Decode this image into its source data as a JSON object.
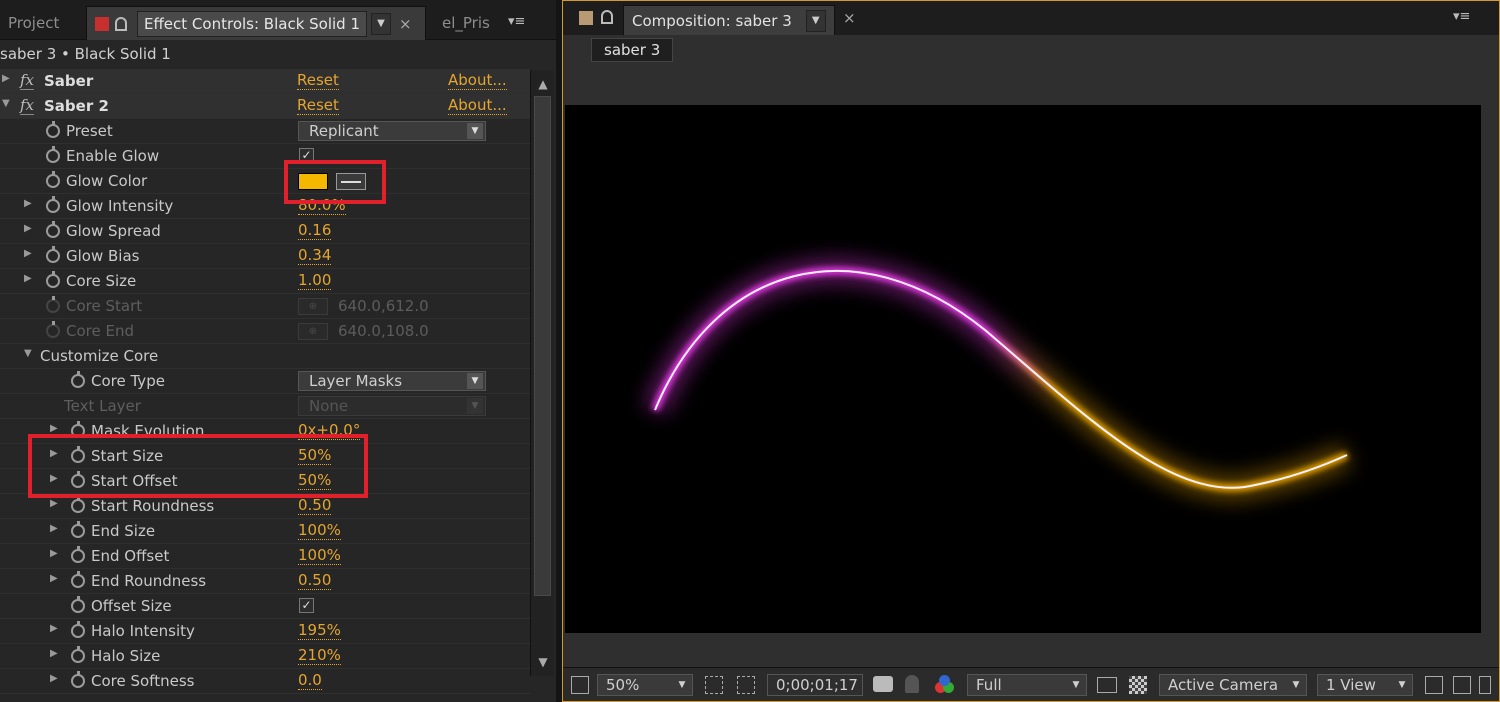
{
  "effect_panel": {
    "tabs": {
      "project": "Project",
      "effect_controls": "Effect Controls: Black Solid 1",
      "truncated": "el_Pris"
    },
    "breadcrumb": "saber 3 • Black Solid 1",
    "effects": [
      {
        "name": "Saber",
        "reset": "Reset",
        "about": "About..."
      },
      {
        "name": "Saber 2",
        "reset": "Reset",
        "about": "About..."
      }
    ],
    "preset": {
      "label": "Preset",
      "value": "Replicant"
    },
    "enable_glow": {
      "label": "Enable Glow",
      "checked": true
    },
    "glow_color": {
      "label": "Glow Color",
      "color": "#f4b800"
    },
    "glow_intensity": {
      "label": "Glow Intensity",
      "value": "80.0%"
    },
    "glow_spread": {
      "label": "Glow Spread",
      "value": "0.16"
    },
    "glow_bias": {
      "label": "Glow Bias",
      "value": "0.34"
    },
    "core_size": {
      "label": "Core Size",
      "value": "1.00"
    },
    "core_start": {
      "label": "Core Start",
      "value": "640.0,612.0"
    },
    "core_end": {
      "label": "Core End",
      "value": "640.0,108.0"
    },
    "customize_core": "Customize Core",
    "core_type": {
      "label": "Core Type",
      "value": "Layer Masks"
    },
    "text_layer": {
      "label": "Text Layer",
      "value": "None"
    },
    "mask_evolution": {
      "label": "Mask Evolution",
      "value": "0x+0.0°"
    },
    "start_size": {
      "label": "Start Size",
      "value": "50%"
    },
    "start_offset": {
      "label": "Start Offset",
      "value": "50%"
    },
    "start_roundness": {
      "label": "Start Roundness",
      "value": "0.50"
    },
    "end_size": {
      "label": "End Size",
      "value": "100%"
    },
    "end_offset": {
      "label": "End Offset",
      "value": "100%"
    },
    "end_roundness": {
      "label": "End Roundness",
      "value": "0.50"
    },
    "offset_size": {
      "label": "Offset Size",
      "checked": true
    },
    "halo_intensity": {
      "label": "Halo Intensity",
      "value": "195%"
    },
    "halo_size": {
      "label": "Halo Size",
      "value": "210%"
    },
    "core_softness": {
      "label": "Core Softness",
      "value": "0.0"
    }
  },
  "composition": {
    "tab_title": "Composition: saber 3",
    "subtab": "saber 3",
    "zoom": "50%",
    "timecode": "0;00;01;17",
    "resolution": "Full",
    "camera": "Active Camera",
    "views": "1 View"
  },
  "colors": {
    "accent": "#e5a52f",
    "highlight": "#e0202a",
    "saber_start": "#ff40ff",
    "saber_end": "#ffb400"
  }
}
